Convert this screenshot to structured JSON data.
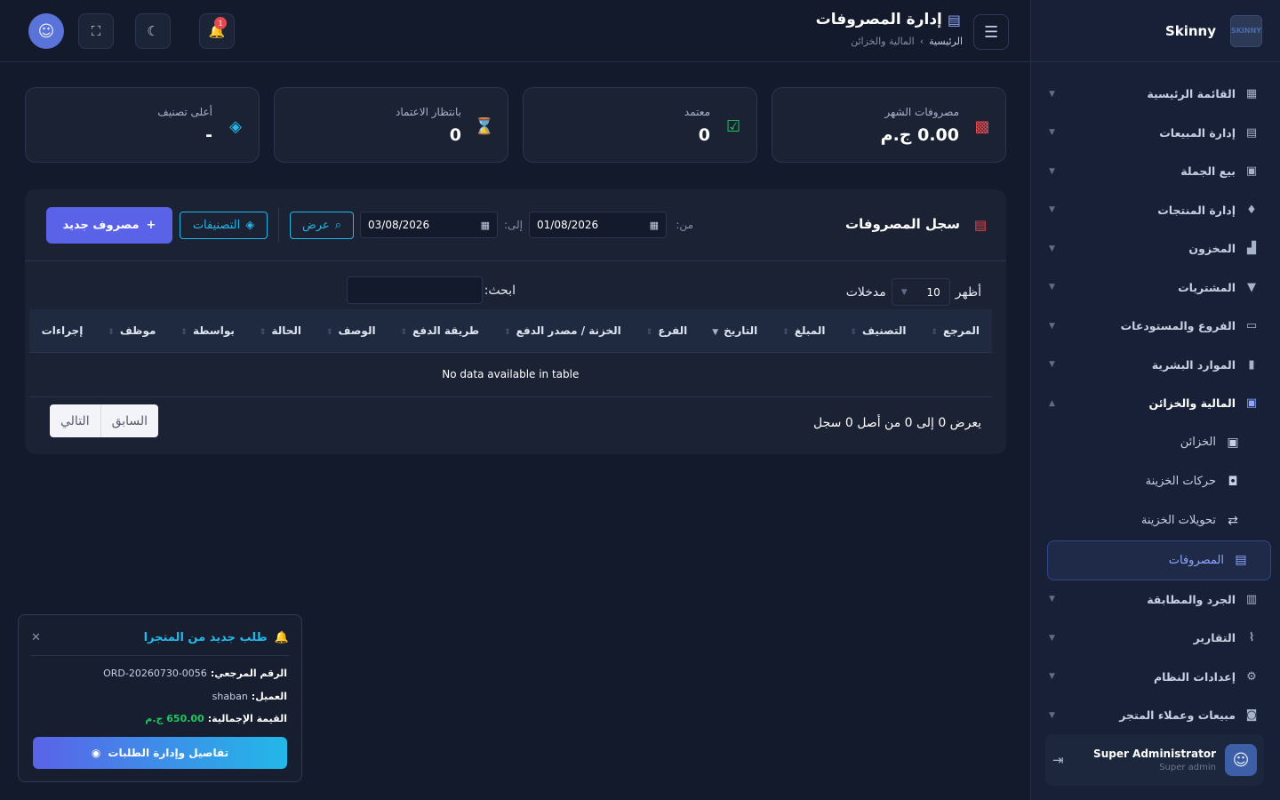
{
  "brand": {
    "name": "Skinny",
    "logo_text": "SKINNY"
  },
  "topbar": {
    "page_title": "إدارة المصروفات",
    "breadcrumb_home": "الرئيسية",
    "breadcrumb_sep": "›",
    "breadcrumb_current": "المالية والخزائن",
    "notif_count": "1"
  },
  "sidebar": {
    "items": [
      {
        "label": "القائمة الرئيسية",
        "icon": "grid-icon"
      },
      {
        "label": "إدارة المبيعات",
        "icon": "register-icon"
      },
      {
        "label": "بيع الجملة",
        "icon": "truck-icon"
      },
      {
        "label": "إدارة المنتجات",
        "icon": "shirt-icon"
      },
      {
        "label": "المخزون",
        "icon": "boxes-icon"
      },
      {
        "label": "المشتريات",
        "icon": "cart-icon"
      },
      {
        "label": "الفروع والمستودعات",
        "icon": "warehouse-icon"
      },
      {
        "label": "الموارد البشرية",
        "icon": "id-card-icon"
      },
      {
        "label": "المالية والخزائن",
        "icon": "safe-icon"
      }
    ],
    "sub_items": [
      {
        "label": "الخزائن",
        "icon": "safe-icon"
      },
      {
        "label": "حركات الخزينة",
        "icon": "money-icon"
      },
      {
        "label": "تحويلات الخزينة",
        "icon": "transfer-icon"
      },
      {
        "label": "المصروفات",
        "icon": "receipt-icon"
      }
    ],
    "items_after": [
      {
        "label": "الجرد والمطابقة",
        "icon": "clipboard-icon"
      },
      {
        "label": "التقارير",
        "icon": "chart-icon"
      },
      {
        "label": "إعدادات النظام",
        "icon": "gear-icon"
      },
      {
        "label": "مبيعات وعملاء المتجر",
        "icon": "bag-icon"
      }
    ],
    "user": {
      "name": "Super Administrator",
      "role": "Super admin"
    }
  },
  "stats": [
    {
      "label": "مصروفات الشهر",
      "value": "0.00 ج.م",
      "icon": "money-bill-icon",
      "color": "#e5484d"
    },
    {
      "label": "معتمد",
      "value": "0",
      "icon": "check-icon",
      "color": "#22c55e"
    },
    {
      "label": "بانتظار الاعتماد",
      "value": "0",
      "icon": "hourglass-icon",
      "color": "#f5b400"
    },
    {
      "label": "أعلى تصنيف",
      "value": "-",
      "icon": "tag-icon",
      "color": "#22b8e8"
    }
  ],
  "panel": {
    "title": "سجل المصروفات",
    "from_label": "من:",
    "from_date": "01/08/2026",
    "to_label": "إلى:",
    "to_date": "03/08/2026",
    "view_btn": "عرض",
    "categories_btn": "التصنيفات",
    "new_btn": "مصروف جديد",
    "show_label": "أظهر",
    "page_length": "10",
    "entries_label": "مدخلات",
    "search_label": "ابحث:",
    "columns": [
      "المرجع",
      "التصنيف",
      "المبلغ",
      "التاريخ",
      "الفرع",
      "الخزنة / مصدر الدفع",
      "طريقة الدفع",
      "الوصف",
      "الحالة",
      "بواسطة",
      "موظف",
      "إجراءات"
    ],
    "empty": "No data available in table",
    "info": "يعرض 0 إلى 0 من أصل 0 سجل",
    "prev": "السابق",
    "next": "التالي"
  },
  "toast": {
    "title": "طلب جديد من المتجرا",
    "ref_label": "الرقم المرجعي:",
    "ref_value": "ORD-20260730-0056",
    "customer_label": "العميل:",
    "customer_value": "shaban",
    "total_label": "القيمة الإجمالية:",
    "total_value": "650.00 ج.م",
    "button": "تفاصيل وإدارة الطلبات"
  },
  "colors": {
    "accent": "#5a63e8",
    "info": "#22b8e8",
    "bg": "#131a2b",
    "sidebar": "#172036"
  }
}
